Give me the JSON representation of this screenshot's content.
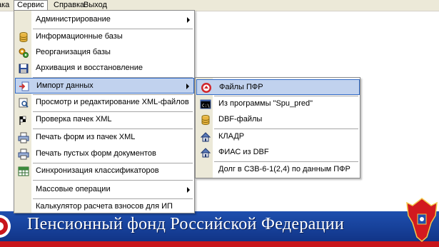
{
  "menubar": {
    "items": [
      "ака",
      "Сервис",
      "Справка",
      "Выход"
    ]
  },
  "service_menu": {
    "items": [
      {
        "label": "Администрирование",
        "icon": "none",
        "submenu": true
      },
      {
        "label": "Информационные базы",
        "icon": "database-icon"
      },
      {
        "label": "Реорганизация базы",
        "icon": "gears-icon"
      },
      {
        "label": "Архивация и восстановление",
        "icon": "floppy-icon"
      },
      {
        "label": "Импорт данных",
        "icon": "import-icon",
        "submenu": true,
        "highlighted": true
      },
      {
        "label": "Просмотр и редактирование XML-файлов",
        "icon": "xml-view-icon"
      },
      {
        "label": "Проверка пачек XML",
        "icon": "check-flag-icon"
      },
      {
        "label": "Печать форм из пачек XML",
        "icon": "printer-icon"
      },
      {
        "label": "Печать пустых форм документов",
        "icon": "printer-icon"
      },
      {
        "label": "Синхронизация классификаторов",
        "icon": "grid-sync-icon"
      },
      {
        "label": "Массовые операции",
        "icon": "none",
        "submenu": true
      },
      {
        "label": "Калькулятор расчета взносов для ИП",
        "icon": "none"
      }
    ]
  },
  "import_submenu": {
    "items": [
      {
        "label": "Файлы ПФР",
        "icon": "pfr-logo-icon",
        "highlighted": true
      },
      {
        "label": "Из программы \"Spu_pred\"",
        "icon": "console-icon"
      },
      {
        "label": "DBF-файлы",
        "icon": "database-icon"
      },
      {
        "label": "КЛАДР",
        "icon": "house-icon"
      },
      {
        "label": "ФИАС из DBF",
        "icon": "house-icon"
      },
      {
        "label": "Долг в СЗВ-6-1(2,4) по данным ПФР",
        "icon": "none"
      }
    ]
  },
  "banner": {
    "title": "Пенсионный фонд Российской Федерации"
  },
  "colors": {
    "menu_highlight": "#c1d2ee",
    "menu_highlight_border": "#316ac5",
    "banner_blue": "#1f4fae",
    "banner_red": "#c8151b"
  }
}
